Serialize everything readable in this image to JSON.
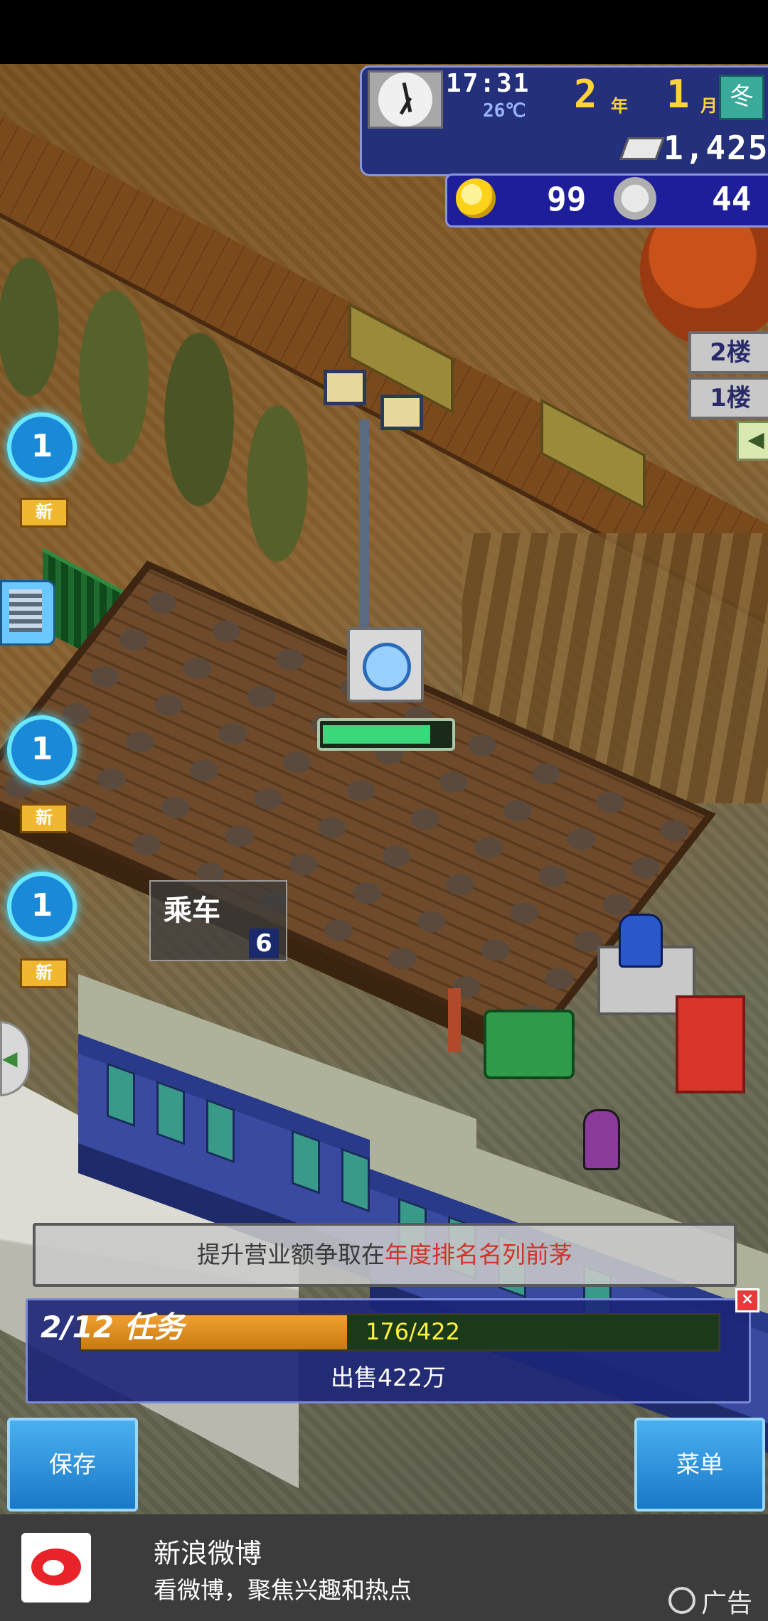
{
  "hud": {
    "time": "17:31",
    "temperature": "26℃",
    "year_value": "2",
    "year_unit": "年",
    "month_value": "1",
    "month_unit": "月",
    "season_icon": "冬",
    "money": "1,425",
    "idea_points": "99",
    "medals": "44"
  },
  "floors": {
    "floor_2": "2楼",
    "floor_1": "1楼"
  },
  "side_notifications": [
    {
      "count": "1",
      "badge": "新"
    },
    {
      "count": "1",
      "badge": "新"
    },
    {
      "count": "1",
      "badge": "新"
    }
  ],
  "station": {
    "ride_label": "乘车",
    "ride_count": "6",
    "construction_progress": 0.85
  },
  "banner": {
    "prefix": "提升营业额争取在",
    "highlight": "年度排名名列前茅"
  },
  "task": {
    "header": "2/12 任务",
    "progress_text": "176/422",
    "progress": 0.417,
    "description": "出售422万",
    "close": "×"
  },
  "buttons": {
    "save": "保存",
    "menu": "菜单"
  },
  "ad": {
    "title": "新浪微博",
    "subtitle": "看微博，聚焦兴趣和热点",
    "label": "广告"
  },
  "colors": {
    "accent_blue": "#1a78c8",
    "highlight_red": "#d0342a",
    "progress_yellow": "#fff03a"
  }
}
